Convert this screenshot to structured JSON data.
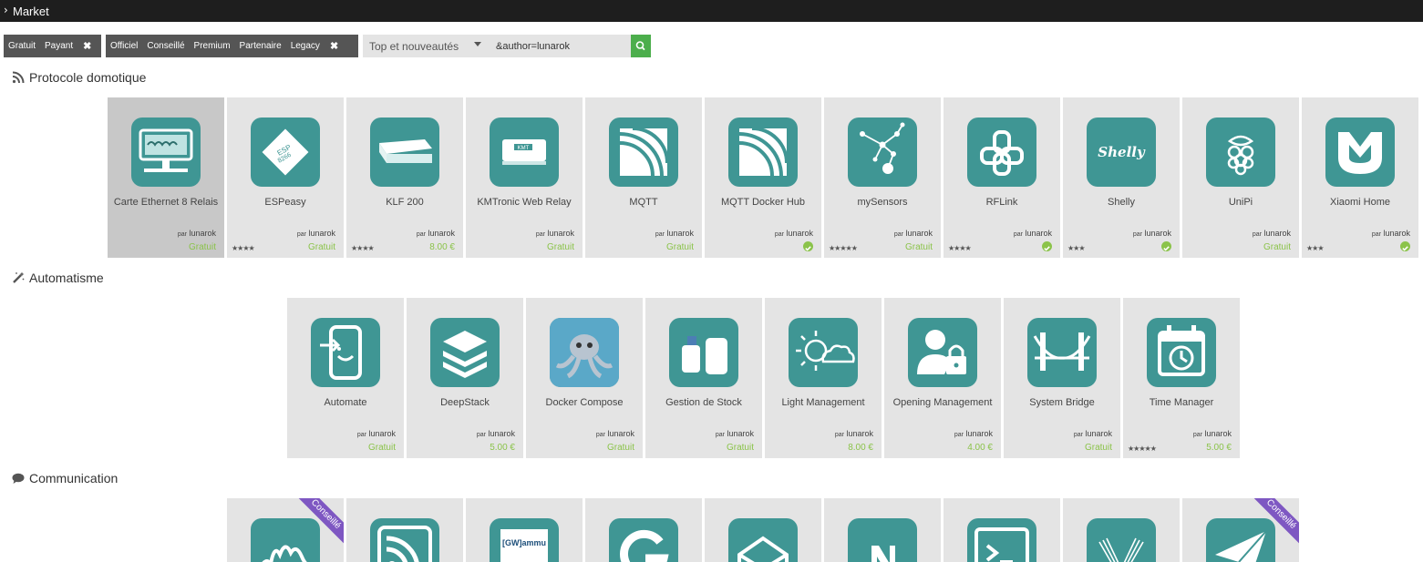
{
  "window": {
    "title": "Market"
  },
  "filters": {
    "price": [
      "Gratuit",
      "Payant"
    ],
    "certification": [
      "Officiel",
      "Conseillé",
      "Premium",
      "Partenaire",
      "Legacy"
    ],
    "close": "✖"
  },
  "sort": {
    "selected": "Top et nouveautés"
  },
  "search": {
    "value": "&author=lunarok"
  },
  "colors": {
    "tile": "#3f9694",
    "price": "#8bc34a",
    "ribbon": "#7e57c2",
    "search_button": "#4cae4c"
  },
  "sections": [
    {
      "title": "Protocole domotique",
      "icon": "rss-icon",
      "plugins": [
        {
          "name": "Carte Ethernet 8 Relais",
          "author": "lunarok",
          "price": "Gratuit",
          "stars": "",
          "icon": "relay-board-icon",
          "highlighted": true
        },
        {
          "name": "ESPeasy",
          "author": "lunarok",
          "price": "Gratuit",
          "stars": "★★★★",
          "icon": "esp-chip-icon"
        },
        {
          "name": "KLF 200",
          "author": "lunarok",
          "price": "8.00 €",
          "stars": "★★★★",
          "icon": "box-device-icon"
        },
        {
          "name": "KMTronic Web Relay",
          "author": "lunarok",
          "price": "Gratuit",
          "stars": "",
          "icon": "kmt-device-icon"
        },
        {
          "name": "MQTT",
          "author": "lunarok",
          "price": "Gratuit",
          "stars": "",
          "icon": "mqtt-icon"
        },
        {
          "name": "MQTT Docker Hub",
          "author": "lunarok",
          "price": "installed",
          "stars": "",
          "icon": "mqtt-icon"
        },
        {
          "name": "mySensors",
          "author": "lunarok",
          "price": "Gratuit",
          "stars": "★★★★★",
          "icon": "network-nodes-icon"
        },
        {
          "name": "RFLink",
          "author": "lunarok",
          "price": "installed",
          "stars": "★★★★",
          "icon": "link-icon"
        },
        {
          "name": "Shelly",
          "author": "lunarok",
          "price": "installed",
          "stars": "★★★",
          "icon": "shelly-logo-icon"
        },
        {
          "name": "UniPi",
          "author": "lunarok",
          "price": "Gratuit",
          "stars": "",
          "icon": "raspberry-icon"
        },
        {
          "name": "Xiaomi Home",
          "author": "lunarok",
          "price": "installed",
          "stars": "★★★",
          "icon": "xiaomi-logo-icon"
        }
      ]
    },
    {
      "title": "Automatisme",
      "icon": "magic-wand-icon",
      "plugins": [
        {
          "name": "Automate",
          "author": "lunarok",
          "price": "Gratuit",
          "stars": "",
          "icon": "phone-icon"
        },
        {
          "name": "DeepStack",
          "author": "lunarok",
          "price": "5.00 €",
          "stars": "",
          "icon": "layers-icon"
        },
        {
          "name": "Docker Compose",
          "author": "lunarok",
          "price": "Gratuit",
          "stars": "",
          "icon": "octopus-icon"
        },
        {
          "name": "Gestion de Stock",
          "author": "lunarok",
          "price": "Gratuit",
          "stars": "",
          "icon": "barrels-icon"
        },
        {
          "name": "Light Management",
          "author": "lunarok",
          "price": "8.00 €",
          "stars": "",
          "icon": "sun-cloud-icon"
        },
        {
          "name": "Opening Management",
          "author": "lunarok",
          "price": "4.00 €",
          "stars": "",
          "icon": "user-lock-icon"
        },
        {
          "name": "System Bridge",
          "author": "lunarok",
          "price": "Gratuit",
          "stars": "",
          "icon": "bridge-icon"
        },
        {
          "name": "Time Manager",
          "author": "lunarok",
          "price": "5.00 €",
          "stars": "★★★★★",
          "icon": "calendar-clock-icon"
        }
      ]
    },
    {
      "title": "Communication",
      "icon": "comment-icon",
      "plugins": [
        {
          "ribbon": "Conseillé",
          "icon": "wave-icon"
        },
        {
          "icon": "feed-icon"
        },
        {
          "icon": "gammu-icon",
          "label": "[GW]ammu"
        },
        {
          "icon": "g-logo-icon"
        },
        {
          "icon": "envelope-icon"
        },
        {
          "icon": "n-logo-icon"
        },
        {
          "icon": "terminal-icon"
        },
        {
          "icon": "stripes-icon"
        },
        {
          "ribbon": "Conseillé",
          "icon": "paper-plane-icon"
        }
      ]
    }
  ],
  "labels": {
    "by": "par"
  }
}
